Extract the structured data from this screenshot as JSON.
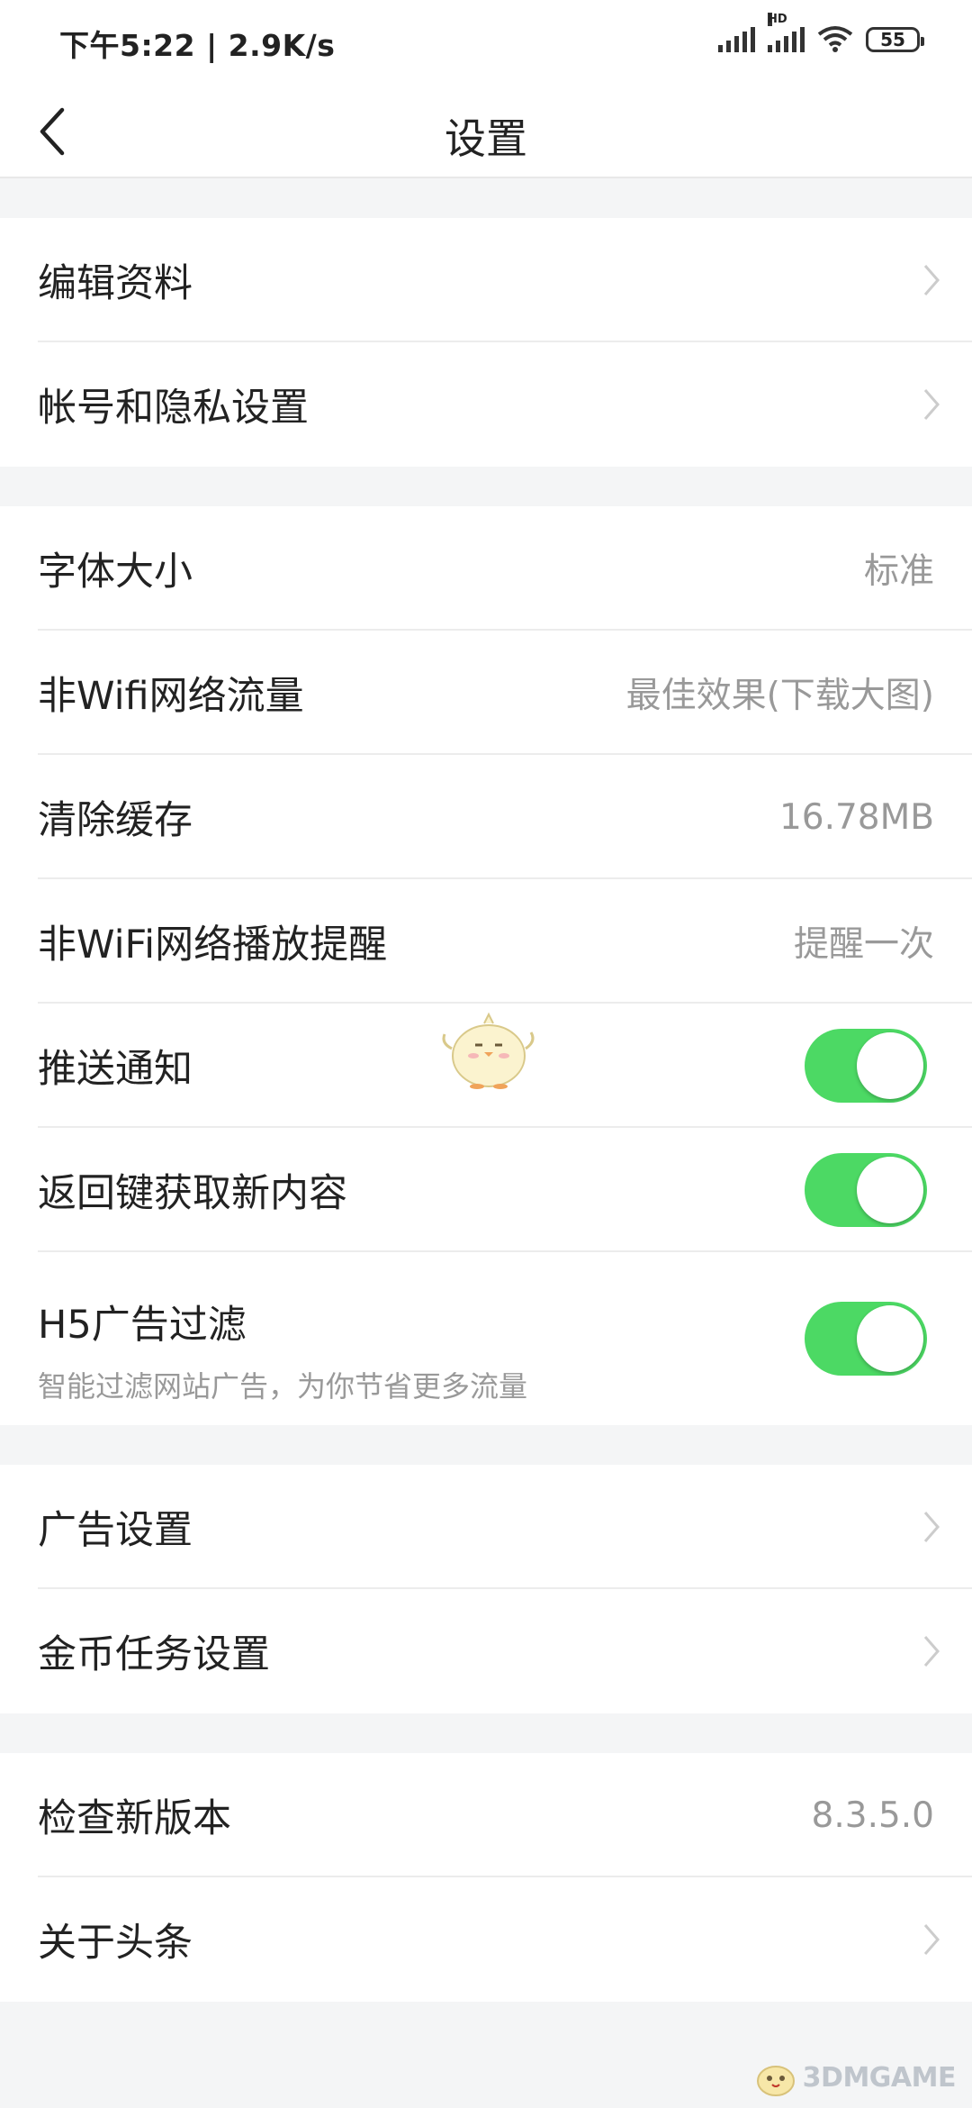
{
  "status": {
    "time_speed": "下午5:22 | 2.9K/s",
    "battery": "55",
    "hd": "HD"
  },
  "header": {
    "title": "设置"
  },
  "group1": [
    {
      "label": "编辑资料"
    },
    {
      "label": "帐号和隐私设置"
    }
  ],
  "group2": {
    "font_size": {
      "label": "字体大小",
      "value": "标准"
    },
    "nonwifi_traffic": {
      "label": "非Wifi网络流量",
      "value": "最佳效果(下载大图)"
    },
    "clear_cache": {
      "label": "清除缓存",
      "value": "16.78MB"
    },
    "nonwifi_play": {
      "label": "非WiFi网络播放提醒",
      "value": "提醒一次"
    },
    "push": {
      "label": "推送通知",
      "on": true
    },
    "back_refresh": {
      "label": "返回键获取新内容",
      "on": true
    },
    "h5_filter": {
      "label": "H5广告过滤",
      "sublabel": "智能过滤网站广告，为你节省更多流量",
      "on": true
    }
  },
  "group3": [
    {
      "label": "广告设置"
    },
    {
      "label": "金币任务设置"
    }
  ],
  "group4": {
    "check_version": {
      "label": "检查新版本",
      "value": "8.3.5.0"
    },
    "about": {
      "label": "关于头条"
    }
  },
  "watermark": {
    "text": "3DMGAME"
  },
  "colors": {
    "toggle_on": "#4cd964",
    "value_gray": "#999999",
    "bg": "#f4f5f6"
  }
}
